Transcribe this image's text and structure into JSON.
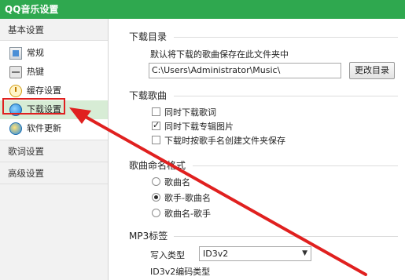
{
  "window": {
    "title": "QQ音乐设置"
  },
  "sidebar": {
    "group_basic": "基本设置",
    "items": [
      {
        "label": "常规",
        "icon": "normal-settings-icon"
      },
      {
        "label": "热键",
        "icon": "hotkey-icon"
      },
      {
        "label": "缓存设置",
        "icon": "cache-icon"
      },
      {
        "label": "下载设置",
        "icon": "download-icon",
        "active": true
      },
      {
        "label": "软件更新",
        "icon": "update-icon"
      }
    ],
    "group_lyrics": "歌词设置",
    "group_advanced": "高级设置"
  },
  "main": {
    "download_dir": {
      "title": "下载目录",
      "desc": "默认将下载的歌曲保存在此文件夹中",
      "path_value": "C:\\Users\\Administrator\\Music\\",
      "change_button": "更改目录"
    },
    "download_songs": {
      "title": "下载歌曲",
      "options": [
        {
          "label": "同时下载歌词",
          "checked": false
        },
        {
          "label": "同时下载专辑图片",
          "checked": true
        },
        {
          "label": "下载时按歌手名创建文件夹保存",
          "checked": false
        }
      ]
    },
    "naming": {
      "title": "歌曲命名格式",
      "options": [
        {
          "label": "歌曲名",
          "checked": false
        },
        {
          "label": "歌手-歌曲名",
          "checked": true
        },
        {
          "label": "歌曲名-歌手",
          "checked": false
        }
      ]
    },
    "mp3_tags": {
      "title": "MP3标签",
      "write_type_label": "写入类型",
      "write_type_value": "ID3v2",
      "encoding_label": "ID3v2编码类型"
    }
  },
  "annotation_color": "#e0201f"
}
